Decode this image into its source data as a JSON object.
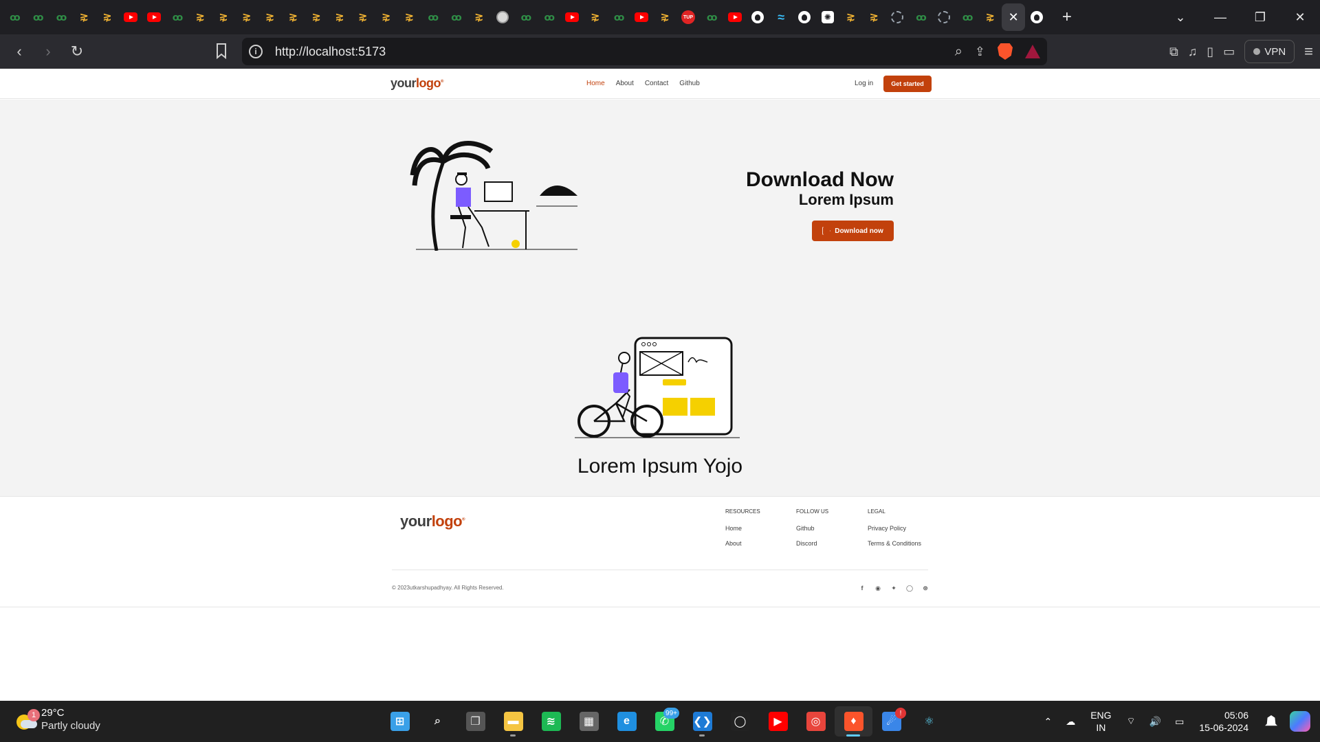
{
  "browser": {
    "tabs": [
      {
        "icon": "gfg-icon"
      },
      {
        "icon": "gfg-icon"
      },
      {
        "icon": "gfg-icon"
      },
      {
        "icon": "arrow-icon"
      },
      {
        "icon": "arrow-icon"
      },
      {
        "icon": "youtube-icon"
      },
      {
        "icon": "youtube-icon"
      },
      {
        "icon": "gfg-icon"
      },
      {
        "icon": "arrow-icon"
      },
      {
        "icon": "arrow-icon"
      },
      {
        "icon": "arrow-icon"
      },
      {
        "icon": "arrow-icon"
      },
      {
        "icon": "arrow-icon"
      },
      {
        "icon": "arrow-icon"
      },
      {
        "icon": "arrow-icon"
      },
      {
        "icon": "arrow-icon"
      },
      {
        "icon": "arrow-icon"
      },
      {
        "icon": "arrow-icon"
      },
      {
        "icon": "gfg-icon"
      },
      {
        "icon": "gfg-icon"
      },
      {
        "icon": "arrow-icon"
      },
      {
        "icon": "globe-icon"
      },
      {
        "icon": "gfg-icon"
      },
      {
        "icon": "gfg-icon"
      },
      {
        "icon": "youtube-icon"
      },
      {
        "icon": "arrow-icon"
      },
      {
        "icon": "gfg-icon"
      },
      {
        "icon": "youtube-icon"
      },
      {
        "icon": "arrow-icon"
      },
      {
        "icon": "tup-icon"
      },
      {
        "icon": "gfg-icon"
      },
      {
        "icon": "youtube-icon"
      },
      {
        "icon": "github-icon"
      },
      {
        "icon": "tailwind-icon"
      },
      {
        "icon": "github-icon"
      },
      {
        "icon": "chatgpt-icon"
      },
      {
        "icon": "arrow-icon"
      },
      {
        "icon": "arrow-icon"
      },
      {
        "icon": "dashed-circle-icon"
      },
      {
        "icon": "gfg-icon"
      },
      {
        "icon": "dashed-circle-icon"
      },
      {
        "icon": "gfg-icon"
      },
      {
        "icon": "arrow-icon"
      },
      {
        "icon": "close-icon",
        "active": true
      },
      {
        "icon": "github-icon"
      }
    ],
    "tab_glyphs": {
      "gfg": "ꝏ",
      "arrow": "⋧",
      "tup": "TUP",
      "chatgpt": "✺",
      "tailwind": "≈",
      "close": "✕"
    },
    "new_tab": "+",
    "window_controls": {
      "dropdown": "⌄",
      "minimize": "—",
      "restore": "❐",
      "close": "✕"
    },
    "nav": {
      "back": "‹",
      "forward": "›",
      "reload": "↻"
    },
    "url": "http://localhost:5173",
    "vpn_label": "VPN",
    "toolbar_icons": {
      "zoom": "⌕",
      "share": "⇪",
      "extensions": "⧉",
      "media": "♫",
      "sidebar": "▯",
      "wallet": "▭",
      "menu": "≡"
    }
  },
  "site": {
    "logo": {
      "part1": "your",
      "part2": "logo",
      "mark": "®"
    },
    "nav_links": [
      "Home",
      "About",
      "Contact",
      "Github"
    ],
    "login": "Log in",
    "get_started": "Get started",
    "hero": {
      "title": "Download Now",
      "subtitle": "Lorem Ipsum",
      "button": "Download now"
    },
    "section_title": "Lorem Ipsum Yojo",
    "footer": {
      "columns": [
        {
          "heading": "RESOURCES",
          "links": [
            "Home",
            "About"
          ]
        },
        {
          "heading": "FOLLOW US",
          "links": [
            "Github",
            "Discord"
          ]
        },
        {
          "heading": "LEGAL",
          "links": [
            "Privacy Policy",
            "Terms & Conditions"
          ]
        }
      ],
      "copyright": "© 2023utkarshupadhyay. All Rights Reserved.",
      "social_glyphs": {
        "facebook": "f",
        "discord": "◉",
        "twitter": "✦",
        "github": "◯",
        "dribbble": "⊛"
      }
    },
    "accent_color": "#c2410c"
  },
  "taskbar": {
    "weather": {
      "badge": "1",
      "temp": "29°C",
      "desc": "Partly cloudy"
    },
    "apps": [
      {
        "name": "start",
        "glyph": "⊞"
      },
      {
        "name": "search",
        "glyph": "⌕"
      },
      {
        "name": "task-view",
        "glyph": "❐"
      },
      {
        "name": "file-explorer",
        "glyph": "▬"
      },
      {
        "name": "spotify",
        "glyph": "≋"
      },
      {
        "name": "calculator",
        "glyph": "▦"
      },
      {
        "name": "edge",
        "glyph": "e"
      },
      {
        "name": "whatsapp",
        "glyph": "✆",
        "badge": "99+"
      },
      {
        "name": "vscode",
        "glyph": "❮❯"
      },
      {
        "name": "github-desktop",
        "glyph": "◯"
      },
      {
        "name": "youtube",
        "glyph": "▶"
      },
      {
        "name": "chrome",
        "glyph": "◎"
      },
      {
        "name": "brave",
        "glyph": "♦"
      },
      {
        "name": "app-badge",
        "glyph": "☄",
        "badge": "!"
      },
      {
        "name": "react-devtools",
        "glyph": "⚛"
      }
    ],
    "tray": {
      "chevron": "⌃",
      "cloud": "☁",
      "lang1": "ENG",
      "lang2": "IN",
      "wifi": "⌔",
      "volume": "🔊",
      "battery": "▭",
      "time": "05:06",
      "date": "15-06-2024"
    }
  }
}
